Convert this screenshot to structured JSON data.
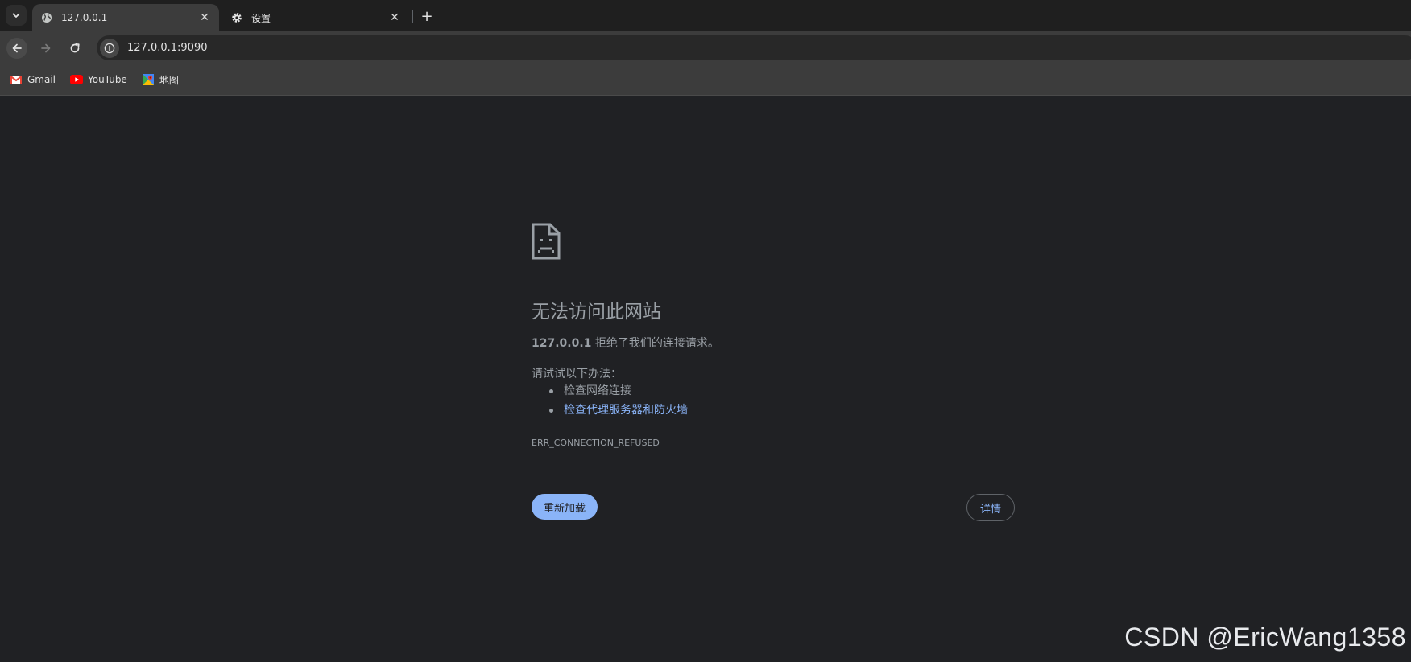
{
  "tabs": [
    {
      "label": "127.0.0.1",
      "icon": "globe-icon",
      "active": true
    },
    {
      "label": "设置",
      "icon": "gear-icon",
      "active": false
    }
  ],
  "toolbar": {
    "url": "127.0.0.1:9090"
  },
  "bookmarks": [
    {
      "label": "Gmail",
      "icon": "gmail-icon"
    },
    {
      "label": "YouTube",
      "icon": "youtube-icon"
    },
    {
      "label": "地图",
      "icon": "maps-icon"
    }
  ],
  "error": {
    "headline": "无法访问此网站",
    "host": "127.0.0.1",
    "description": " 拒绝了我们的连接请求。",
    "try_label": "请试试以下办法：",
    "suggestions": [
      {
        "text": "检查网络连接",
        "link": false
      },
      {
        "text": "检查代理服务器和防火墙",
        "link": true
      }
    ],
    "code": "ERR_CONNECTION_REFUSED",
    "reload_label": "重新加载",
    "details_label": "详情"
  },
  "watermark": "CSDN @EricWang1358",
  "colors": {
    "background": "#202124",
    "accent": "#8ab4f8",
    "text_secondary": "#9aa0a6",
    "toolbar": "#3c3c3c"
  }
}
